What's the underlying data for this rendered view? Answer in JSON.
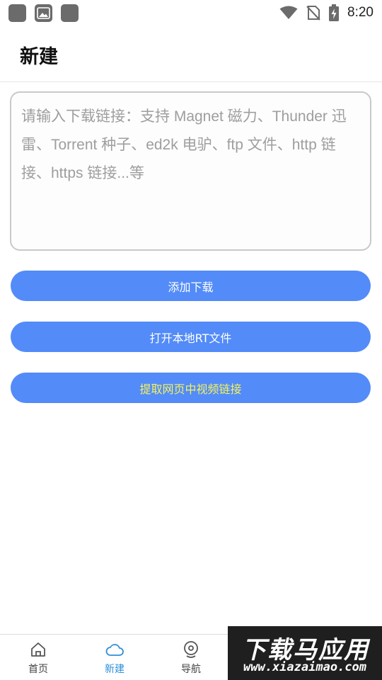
{
  "status_bar": {
    "time": "8:20",
    "left_icons": [
      "app-notification-icon",
      "image-notification-icon",
      "app-notification-icon"
    ],
    "right_icons": [
      "wifi-icon",
      "no-sim-icon",
      "battery-charging-icon"
    ]
  },
  "header": {
    "title": "新建"
  },
  "link_input": {
    "value": "",
    "placeholder": "请输入下载链接：支持 Magnet 磁力、Thunder 迅雷、Torrent 种子、ed2k 电驴、ftp 文件、http 链接、https 链接...等"
  },
  "actions": {
    "add_download": "添加下载",
    "open_local_rt": "打开本地RT文件",
    "extract_video_links": "提取网页中视频链接"
  },
  "colors": {
    "button_bg": "#538bf8",
    "button_text": "#ffffff",
    "extract_text": "#f4f35a",
    "active_tab": "#2f8fd8"
  },
  "bottom_nav": {
    "items": [
      {
        "label": "首页",
        "icon": "home-icon",
        "active": false
      },
      {
        "label": "新建",
        "icon": "cloud-icon",
        "active": true
      },
      {
        "label": "导航",
        "icon": "compass-icon",
        "active": false
      }
    ]
  },
  "watermark": {
    "title": "下载马应用",
    "url": "www.xiazaimao.com"
  }
}
